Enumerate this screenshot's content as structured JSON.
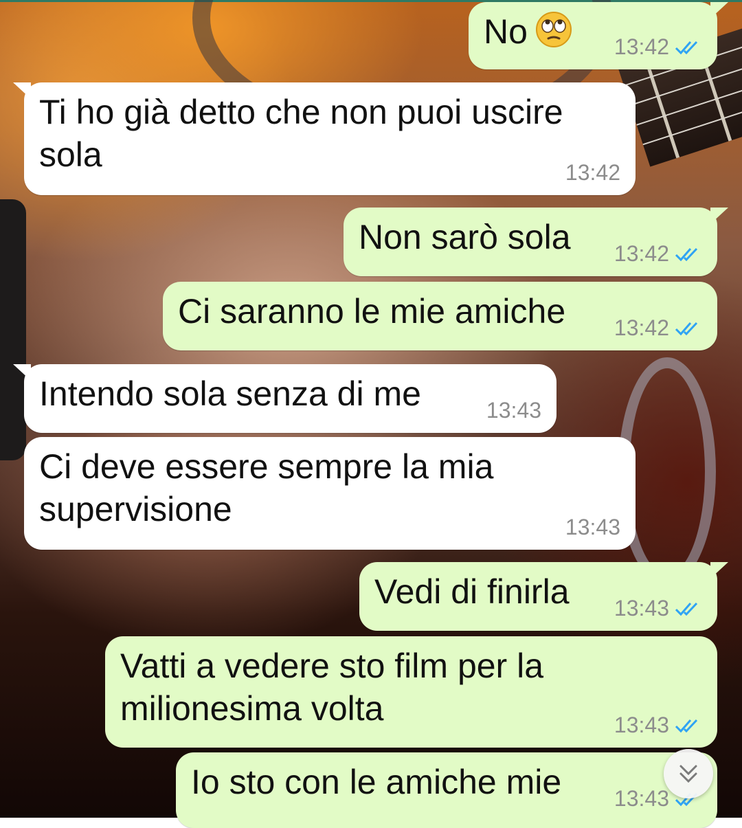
{
  "chat": {
    "messages": [
      {
        "id": "m1",
        "direction": "out",
        "text": "No",
        "emoji": "face-with-rolling-eyes",
        "time": "13:42",
        "status": "read"
      },
      {
        "id": "m2",
        "direction": "in",
        "text": "Ti ho già detto che non puoi uscire sola",
        "time": "13:42"
      },
      {
        "id": "m3",
        "direction": "out",
        "text": "Non sarò sola",
        "time": "13:42",
        "status": "read"
      },
      {
        "id": "m4",
        "direction": "out",
        "text": "Ci saranno le mie amiche",
        "time": "13:42",
        "status": "read"
      },
      {
        "id": "m5",
        "direction": "in",
        "text": "Intendo sola senza di me",
        "time": "13:43"
      },
      {
        "id": "m6",
        "direction": "in",
        "text": "Ci deve essere sempre la mia supervisione",
        "time": "13:43"
      },
      {
        "id": "m7",
        "direction": "out",
        "text": "Vedi di finirla",
        "time": "13:43",
        "status": "read"
      },
      {
        "id": "m8",
        "direction": "out",
        "text": "Vatti a vedere sto film per la milionesima volta",
        "time": "13:43",
        "status": "read"
      },
      {
        "id": "m9",
        "direction": "out",
        "text": "Io sto con le amiche mie",
        "time": "13:43",
        "status": "read"
      }
    ]
  },
  "scroll_button": {
    "icon": "double-chevron-down-icon"
  },
  "colors": {
    "incoming_bubble": "#ffffff",
    "outgoing_bubble": "#e2fbc6",
    "read_ticks": "#2fa3f4",
    "timestamp": "#8c8c8c"
  }
}
